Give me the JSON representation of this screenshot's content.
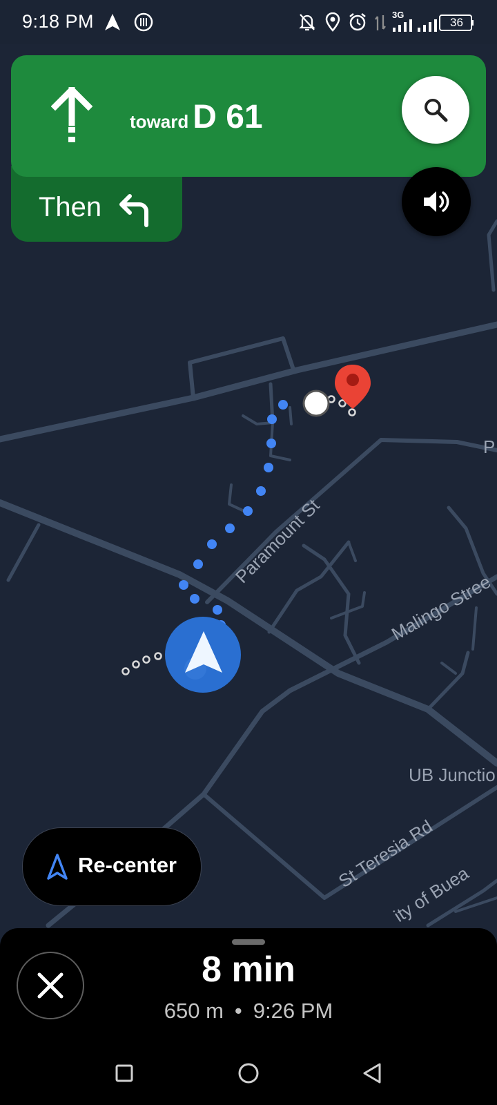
{
  "status_bar": {
    "time": "9:18 PM",
    "network": "3G",
    "battery": "36",
    "icons": [
      "navigation-arrow-icon",
      "app-icon",
      "bell-off-icon",
      "location-icon",
      "alarm-icon",
      "data-arrows-icon",
      "signal-icon",
      "signal-icon-2",
      "battery-icon"
    ]
  },
  "direction": {
    "icon": "arrow-straight-icon",
    "toward_word": "toward",
    "road": "D 61"
  },
  "next_turn": {
    "label": "Then",
    "icon": "turn-left-icon"
  },
  "buttons": {
    "search_icon": "search-icon",
    "sound_icon": "volume-icon",
    "recenter_label": "Re-center",
    "recenter_icon": "navigation-arrow-icon"
  },
  "map": {
    "streets": {
      "paramount": "Paramount St",
      "malingo": "Malingo Stree",
      "junction": "UB Junctio",
      "st_teresia": "St Teresia Rd",
      "university": "ity of Buea",
      "edge": "P"
    },
    "colors": {
      "background": "#1c2536",
      "road": "#3b4a60",
      "route": "#4285f4",
      "destination": "#ea4335"
    }
  },
  "trip": {
    "duration": "8 min",
    "distance": "650 m",
    "separator": "•",
    "arrival": "9:26 PM"
  },
  "nav_bar": {
    "icons": [
      "recent-apps-icon",
      "home-icon",
      "back-icon"
    ]
  },
  "accent_colors": {
    "nav_green": "#1e8a3d",
    "then_green": "#146c2e"
  }
}
